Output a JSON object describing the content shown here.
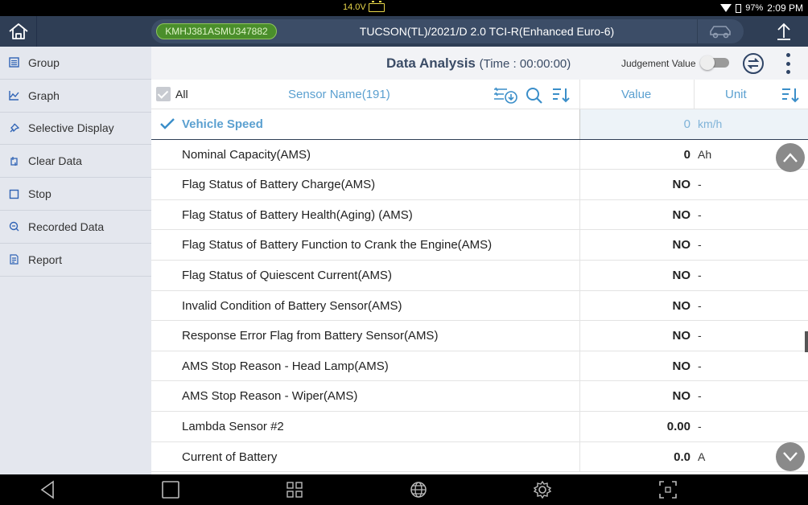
{
  "status_bar": {
    "voltage": "14.0V",
    "battery_pct": "97%",
    "clock": "2:09 PM"
  },
  "header": {
    "vin": "KMHJ381ASMU347882",
    "vehicle": "TUCSON(TL)/2021/D 2.0 TCI-R(Enhanced Euro-6)"
  },
  "sidebar": {
    "items": [
      {
        "label": "Group",
        "icon": "group-icon"
      },
      {
        "label": "Graph",
        "icon": "graph-icon"
      },
      {
        "label": "Selective Display",
        "icon": "pin-icon"
      },
      {
        "label": "Clear Data",
        "icon": "clear-icon"
      },
      {
        "label": "Stop",
        "icon": "stop-icon"
      },
      {
        "label": "Recorded Data",
        "icon": "recorded-icon"
      },
      {
        "label": "Report",
        "icon": "report-icon"
      }
    ]
  },
  "main": {
    "title": "Data Analysis",
    "time": "(Time : 00:00:00)",
    "judgement_label": "Judgement Value",
    "columns": {
      "all": "All",
      "sensor": "Sensor Name(191)",
      "value": "Value",
      "unit": "Unit"
    },
    "selected_row": {
      "name": "Vehicle Speed",
      "value": "0",
      "unit": "km/h"
    },
    "rows": [
      {
        "name": "Nominal Capacity(AMS)",
        "value": "0",
        "unit": "Ah"
      },
      {
        "name": "Flag Status of Battery Charge(AMS)",
        "value": "NO",
        "unit": "-"
      },
      {
        "name": "Flag Status of Battery Health(Aging) (AMS)",
        "value": "NO",
        "unit": "-"
      },
      {
        "name": "Flag Status of Battery Function to Crank the Engine(AMS)",
        "value": "NO",
        "unit": "-"
      },
      {
        "name": "Flag Status of Quiescent Current(AMS)",
        "value": "NO",
        "unit": "-"
      },
      {
        "name": "Invalid Condition of Battery Sensor(AMS)",
        "value": "NO",
        "unit": "-"
      },
      {
        "name": "Response Error Flag from Battery Sensor(AMS)",
        "value": "NO",
        "unit": "-"
      },
      {
        "name": "AMS Stop Reason - Head Lamp(AMS)",
        "value": "NO",
        "unit": "-"
      },
      {
        "name": "AMS Stop Reason - Wiper(AMS)",
        "value": "NO",
        "unit": "-"
      },
      {
        "name": "Lambda Sensor #2",
        "value": "0.00",
        "unit": "-"
      },
      {
        "name": "Current of Battery",
        "value": "0.0",
        "unit": "A"
      }
    ]
  },
  "colors": {
    "header": "#2f3e55",
    "vin_badge": "#4a8e2b",
    "accent": "#5ba0d0",
    "sidebar": "#e4e7ee"
  }
}
